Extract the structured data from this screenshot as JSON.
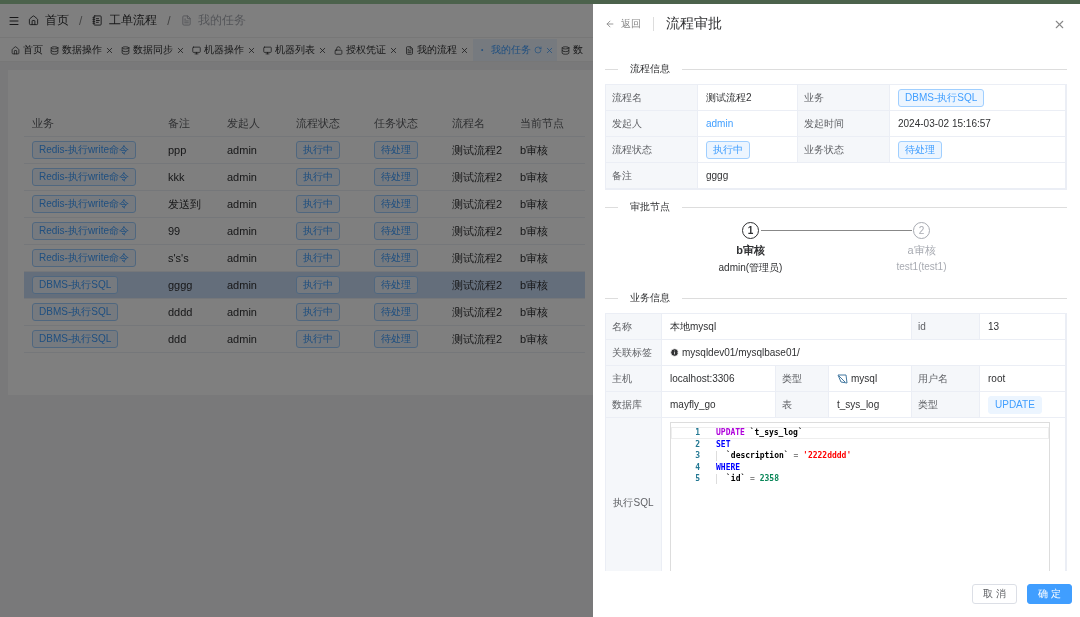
{
  "breadcrumb": [
    {
      "label": "首页",
      "kind": "home",
      "current": false
    },
    {
      "separator": "/",
      "label": "工单流程",
      "kind": "notebook",
      "current": false
    },
    {
      "separator": "/",
      "label": "我的任务",
      "kind": "document",
      "current": true
    }
  ],
  "tabs": [
    {
      "label": "首页",
      "kind": "home",
      "closable": false,
      "selected": false
    },
    {
      "label": "数据操作",
      "kind": "database",
      "closable": true,
      "selected": false
    },
    {
      "label": "数据同步",
      "kind": "database",
      "closable": true,
      "selected": false
    },
    {
      "label": "机器操作",
      "kind": "monitor",
      "closable": true,
      "selected": false
    },
    {
      "label": "机器列表",
      "kind": "monitor",
      "closable": true,
      "selected": false
    },
    {
      "label": "授权凭证",
      "kind": "lock",
      "closable": true,
      "selected": false
    },
    {
      "label": "我的流程",
      "kind": "document",
      "closable": true,
      "selected": false
    },
    {
      "label": "我的任务",
      "kind": "dot",
      "closable": true,
      "selected": true
    },
    {
      "label": "数",
      "kind": "database",
      "closable": false,
      "selected": false
    }
  ],
  "table": {
    "columns": [
      "业务",
      "备注",
      "发起人",
      "流程状态",
      "任务状态",
      "流程名",
      "当前节点"
    ],
    "rows": [
      {
        "business": "Redis-执行write命令",
        "remark": "ppp",
        "initiator": "admin",
        "flow_status": "执行中",
        "task_status": "待处理",
        "flow_name": "测试流程2",
        "node": "b审核",
        "selected": false
      },
      {
        "business": "Redis-执行write命令",
        "remark": "kkk",
        "initiator": "admin",
        "flow_status": "执行中",
        "task_status": "待处理",
        "flow_name": "测试流程2",
        "node": "b审核",
        "selected": false
      },
      {
        "business": "Redis-执行write命令",
        "remark": "发送到",
        "initiator": "admin",
        "flow_status": "执行中",
        "task_status": "待处理",
        "flow_name": "测试流程2",
        "node": "b审核",
        "selected": false
      },
      {
        "business": "Redis-执行write命令",
        "remark": "99",
        "initiator": "admin",
        "flow_status": "执行中",
        "task_status": "待处理",
        "flow_name": "测试流程2",
        "node": "b审核",
        "selected": false
      },
      {
        "business": "Redis-执行write命令",
        "remark": "s's's",
        "initiator": "admin",
        "flow_status": "执行中",
        "task_status": "待处理",
        "flow_name": "测试流程2",
        "node": "b审核",
        "selected": false
      },
      {
        "business": "DBMS-执行SQL",
        "remark": "gggg",
        "initiator": "admin",
        "flow_status": "执行中",
        "task_status": "待处理",
        "flow_name": "测试流程2",
        "node": "b审核",
        "selected": true
      },
      {
        "business": "DBMS-执行SQL",
        "remark": "dddd",
        "initiator": "admin",
        "flow_status": "执行中",
        "task_status": "待处理",
        "flow_name": "测试流程2",
        "node": "b审核",
        "selected": false
      },
      {
        "business": "DBMS-执行SQL",
        "remark": "ddd",
        "initiator": "admin",
        "flow_status": "执行中",
        "task_status": "待处理",
        "flow_name": "测试流程2",
        "node": "b审核",
        "selected": false
      }
    ]
  },
  "drawer": {
    "back": "返回",
    "title": "流程审批",
    "flow_info": {
      "title": "流程信息",
      "rows": [
        [
          {
            "label": "流程名",
            "value": "测试流程2",
            "kind": "text"
          },
          {
            "label": "业务",
            "value": "DBMS-执行SQL",
            "kind": "tag"
          }
        ],
        [
          {
            "label": "发起人",
            "value": "admin",
            "kind": "link"
          },
          {
            "label": "发起时间",
            "value": "2024-03-02 15:16:57",
            "kind": "text"
          }
        ],
        [
          {
            "label": "流程状态",
            "value": "执行中",
            "kind": "tag"
          },
          {
            "label": "业务状态",
            "value": "待处理",
            "kind": "tag"
          }
        ],
        [
          {
            "label": "备注",
            "value": "gggg",
            "kind": "text"
          },
          {
            "kind": "merged"
          }
        ]
      ]
    },
    "nodes": {
      "title": "审批节点",
      "steps": [
        {
          "number": "1",
          "title": "b审核",
          "desc": "admin(管理员)",
          "active": true
        },
        {
          "number": "2",
          "title": "a审核",
          "desc": "test1(test1)",
          "active": false
        }
      ]
    },
    "biz_info": {
      "title": "业务信息",
      "rows": [
        [
          {
            "label": "名称",
            "value": "本地mysql",
            "kind": "text"
          },
          {
            "kind": "merged"
          },
          {
            "label": "id",
            "value": "13",
            "kind": "text"
          }
        ],
        [
          {
            "label": "关联标签",
            "value": "mysqldev01/mysqlbase01/",
            "kind": "info"
          },
          {
            "kind": "merged"
          },
          {
            "kind": "merged"
          }
        ],
        [
          {
            "label": "主机",
            "value": "localhost:3306",
            "kind": "text"
          },
          {
            "label": "类型",
            "value": "mysql",
            "kind": "dbtype"
          },
          {
            "label": "用户名",
            "value": "root",
            "kind": "text"
          }
        ],
        [
          {
            "label": "数据库",
            "value": "mayfly_go",
            "kind": "text"
          },
          {
            "label": "表",
            "value": "t_sys_log",
            "kind": "text"
          },
          {
            "label": "类型",
            "value": "UPDATE",
            "kind": "badge"
          }
        ]
      ],
      "sql_label": "执行SQL",
      "code": [
        {
          "number": "1",
          "indent": false,
          "tokens": [
            {
              "text": "UPDATE",
              "kind": "keyword2"
            },
            {
              "text": " `t_sys_log`",
              "kind": "ident"
            }
          ]
        },
        {
          "number": "2",
          "indent": false,
          "tokens": [
            {
              "text": "SET",
              "kind": "keyword"
            }
          ]
        },
        {
          "number": "3",
          "indent": true,
          "tokens": [
            {
              "text": "`description`",
              "kind": "ident"
            },
            {
              "text": " = ",
              "kind": "op"
            },
            {
              "text": "'2222dddd'",
              "kind": "string"
            }
          ]
        },
        {
          "number": "4",
          "indent": false,
          "tokens": [
            {
              "text": "WHERE",
              "kind": "keyword"
            }
          ]
        },
        {
          "number": "5",
          "indent": true,
          "tokens": [
            {
              "text": "`id`",
              "kind": "ident"
            },
            {
              "text": " = ",
              "kind": "op"
            },
            {
              "text": "2358",
              "kind": "number"
            }
          ]
        }
      ]
    },
    "buttons": [
      {
        "label": "取 消",
        "kind": "default"
      },
      {
        "label": "确 定",
        "kind": "primary"
      }
    ]
  }
}
